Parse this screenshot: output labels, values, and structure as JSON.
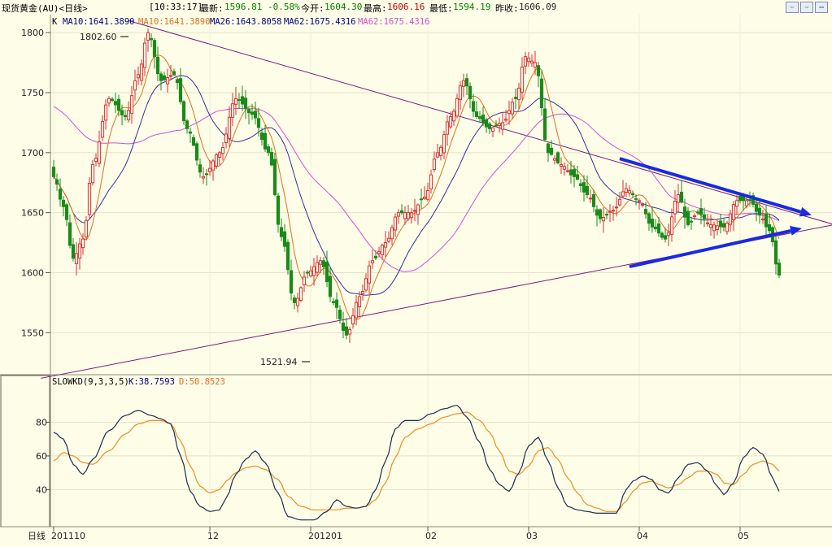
{
  "titlebar": {
    "name": "现货黄金(AU)<日线>",
    "time": "[10:33:17]",
    "latest_label": "最新:",
    "latest_value": "1596.81 -0.58%",
    "open_label": "今开:",
    "open_value": "1604.30",
    "high_label": "最高:",
    "high_value": "1606.16",
    "low_label": "最低:",
    "low_value": "1594.19",
    "prevclose_label": "昨收:",
    "prevclose_value": "1606.09",
    "buttons": [
      "⇦",
      "⇨",
      "▭"
    ]
  },
  "price_legend": {
    "k": "K",
    "ma10_a": "MA10:1641.3890",
    "ma10_b": "MA10:1641.3890",
    "ma26": "MA26:1643.8058",
    "ma62": "MA62:1675.4316",
    "ma62_b": "MA62:1675.4316"
  },
  "kd_legend": {
    "name": "SLOWKD(9,3,3,5)",
    "k": "K:38.7593",
    "d": "D:50.8523"
  },
  "annotations": {
    "high": "1802.60",
    "low": "1521.94"
  },
  "x_axis": {
    "prefix": "日线",
    "labels": [
      "201110",
      "12",
      "201201",
      "02",
      "03",
      "04",
      "05"
    ]
  },
  "colors": {
    "background": "#fdfde8",
    "up_candle": "#d83030",
    "down_candle": "#1a8a1a",
    "ma10": "#e07020",
    "ma26": "#3030a0",
    "ma62": "#d050d0",
    "trendline": "#7a1a7a",
    "arrow": "#1a2ae0",
    "kd_k": "#1c2c50",
    "kd_d": "#ef8c20"
  },
  "chart_data": {
    "type": "candlestick",
    "price_panel": {
      "ylim": [
        1515,
        1815
      ],
      "yticks": [
        1550,
        1600,
        1650,
        1700,
        1750,
        1800
      ],
      "high_annotation": 1802.6,
      "low_annotation": 1521.94
    },
    "kd_panel": {
      "ylim": [
        18,
        100
      ],
      "yticks": [
        40,
        60,
        80
      ],
      "k_anchors": [
        [
          0,
          74
        ],
        [
          3,
          70
        ],
        [
          6,
          55
        ],
        [
          9,
          49
        ],
        [
          12,
          58
        ],
        [
          17,
          75
        ],
        [
          22,
          84
        ],
        [
          26,
          87
        ],
        [
          30,
          84
        ],
        [
          33,
          82
        ],
        [
          36,
          79
        ],
        [
          39,
          60
        ],
        [
          42,
          39
        ],
        [
          45,
          30
        ],
        [
          48,
          27
        ],
        [
          51,
          28
        ],
        [
          53,
          35
        ],
        [
          56,
          49
        ],
        [
          59,
          58
        ],
        [
          62,
          63
        ],
        [
          65,
          56
        ],
        [
          69,
          38
        ],
        [
          72,
          24
        ],
        [
          76,
          22
        ],
        [
          80,
          22
        ],
        [
          84,
          27
        ],
        [
          87,
          34
        ],
        [
          90,
          30
        ],
        [
          93,
          29
        ],
        [
          96,
          30
        ],
        [
          99,
          40
        ],
        [
          102,
          57
        ],
        [
          105,
          76
        ],
        [
          108,
          81
        ],
        [
          112,
          81
        ],
        [
          116,
          85
        ],
        [
          120,
          88
        ],
        [
          124,
          90
        ],
        [
          127,
          83
        ],
        [
          131,
          68
        ],
        [
          134,
          52
        ],
        [
          137,
          43
        ],
        [
          140,
          39
        ],
        [
          143,
          50
        ],
        [
          146,
          66
        ],
        [
          149,
          71
        ],
        [
          152,
          57
        ],
        [
          155,
          41
        ],
        [
          158,
          30
        ],
        [
          161,
          28
        ],
        [
          164,
          27
        ],
        [
          167,
          26
        ],
        [
          170,
          26
        ],
        [
          173,
          26
        ],
        [
          176,
          40
        ],
        [
          178,
          45
        ],
        [
          181,
          48
        ],
        [
          184,
          46
        ],
        [
          186,
          40
        ],
        [
          189,
          38
        ],
        [
          192,
          47
        ],
        [
          195,
          55
        ],
        [
          198,
          56
        ],
        [
          201,
          51
        ],
        [
          204,
          42
        ],
        [
          206,
          37
        ],
        [
          209,
          44
        ],
        [
          212,
          59
        ],
        [
          215,
          65
        ],
        [
          218,
          61
        ],
        [
          221,
          47
        ],
        [
          223,
          39
        ]
      ],
      "d_anchors": [
        [
          0,
          57
        ],
        [
          3,
          62
        ],
        [
          6,
          60
        ],
        [
          9,
          56
        ],
        [
          12,
          55
        ],
        [
          17,
          63
        ],
        [
          22,
          73
        ],
        [
          26,
          79
        ],
        [
          30,
          81
        ],
        [
          33,
          81
        ],
        [
          36,
          79
        ],
        [
          39,
          69
        ],
        [
          42,
          54
        ],
        [
          45,
          42
        ],
        [
          48,
          38
        ],
        [
          51,
          40
        ],
        [
          53,
          45
        ],
        [
          56,
          50
        ],
        [
          59,
          53
        ],
        [
          62,
          54
        ],
        [
          65,
          52
        ],
        [
          69,
          46
        ],
        [
          72,
          36
        ],
        [
          76,
          30
        ],
        [
          80,
          28
        ],
        [
          84,
          28
        ],
        [
          87,
          28
        ],
        [
          90,
          29
        ],
        [
          93,
          29
        ],
        [
          96,
          30
        ],
        [
          99,
          34
        ],
        [
          102,
          44
        ],
        [
          105,
          59
        ],
        [
          108,
          71
        ],
        [
          112,
          76
        ],
        [
          116,
          79
        ],
        [
          120,
          83
        ],
        [
          124,
          85
        ],
        [
          127,
          86
        ],
        [
          131,
          81
        ],
        [
          134,
          74
        ],
        [
          137,
          63
        ],
        [
          140,
          51
        ],
        [
          143,
          49
        ],
        [
          146,
          54
        ],
        [
          149,
          63
        ],
        [
          152,
          65
        ],
        [
          155,
          58
        ],
        [
          158,
          47
        ],
        [
          161,
          38
        ],
        [
          164,
          31
        ],
        [
          167,
          29
        ],
        [
          170,
          27
        ],
        [
          173,
          27
        ],
        [
          176,
          33
        ],
        [
          178,
          39
        ],
        [
          181,
          44
        ],
        [
          184,
          45
        ],
        [
          186,
          43
        ],
        [
          189,
          41
        ],
        [
          192,
          43
        ],
        [
          195,
          47
        ],
        [
          198,
          51
        ],
        [
          201,
          51
        ],
        [
          204,
          49
        ],
        [
          206,
          44
        ],
        [
          209,
          43
        ],
        [
          212,
          49
        ],
        [
          215,
          55
        ],
        [
          218,
          57
        ],
        [
          221,
          55
        ],
        [
          223,
          51
        ]
      ]
    },
    "close_anchors": [
      [
        0,
        1680
      ],
      [
        3,
        1655
      ],
      [
        6,
        1612
      ],
      [
        9,
        1628
      ],
      [
        12,
        1690
      ],
      [
        17,
        1745
      ],
      [
        22,
        1730
      ],
      [
        26,
        1765
      ],
      [
        29,
        1800
      ],
      [
        33,
        1760
      ],
      [
        37,
        1765
      ],
      [
        41,
        1720
      ],
      [
        46,
        1680
      ],
      [
        51,
        1700
      ],
      [
        56,
        1745
      ],
      [
        61,
        1732
      ],
      [
        66,
        1700
      ],
      [
        70,
        1630
      ],
      [
        74,
        1575
      ],
      [
        78,
        1600
      ],
      [
        82,
        1610
      ],
      [
        86,
        1575
      ],
      [
        90,
        1548
      ],
      [
        94,
        1580
      ],
      [
        98,
        1610
      ],
      [
        102,
        1625
      ],
      [
        106,
        1650
      ],
      [
        110,
        1650
      ],
      [
        114,
        1663
      ],
      [
        118,
        1700
      ],
      [
        122,
        1730
      ],
      [
        126,
        1760
      ],
      [
        130,
        1730
      ],
      [
        134,
        1720
      ],
      [
        138,
        1725
      ],
      [
        142,
        1745
      ],
      [
        145,
        1780
      ],
      [
        148,
        1775
      ],
      [
        152,
        1700
      ],
      [
        156,
        1690
      ],
      [
        160,
        1680
      ],
      [
        164,
        1665
      ],
      [
        168,
        1645
      ],
      [
        172,
        1652
      ],
      [
        176,
        1670
      ],
      [
        180,
        1660
      ],
      [
        184,
        1638
      ],
      [
        188,
        1628
      ],
      [
        192,
        1665
      ],
      [
        195,
        1640
      ],
      [
        198,
        1650
      ],
      [
        202,
        1640
      ],
      [
        206,
        1638
      ],
      [
        210,
        1660
      ],
      [
        214,
        1660
      ],
      [
        217,
        1648
      ],
      [
        220,
        1635
      ],
      [
        223,
        1598
      ]
    ],
    "trendlines": [
      {
        "from": [
          23,
          1810
        ],
        "to": [
          240,
          1640
        ]
      },
      {
        "from": [
          -4,
          1512
        ],
        "to": [
          240,
          1640
        ]
      }
    ],
    "arrows": [
      {
        "from": [
          174,
          1695
        ],
        "to": [
          233,
          1648
        ]
      },
      {
        "from": [
          177,
          1605
        ],
        "to": [
          230,
          1637
        ]
      }
    ]
  }
}
